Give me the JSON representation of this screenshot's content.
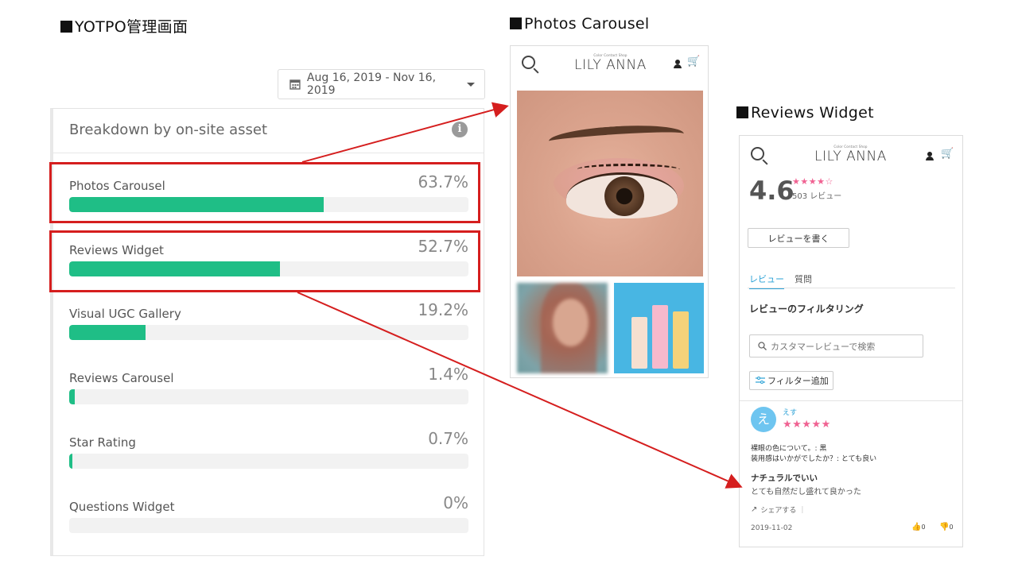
{
  "labels": {
    "yotpo": "YOTPO管理画面",
    "carousel": "Photos Carousel",
    "reviews": "Reviews Widget"
  },
  "dashboard": {
    "date_range": "Aug 16, 2019 - Nov 16, 2019",
    "panel_title": "Breakdown by on-site asset",
    "metrics": [
      {
        "label": "Photos Carousel",
        "value": "63.7%",
        "fraction": 0.637
      },
      {
        "label": "Reviews Widget",
        "value": "52.7%",
        "fraction": 0.527
      },
      {
        "label": "Visual UGC Gallery",
        "value": "19.2%",
        "fraction": 0.192
      },
      {
        "label": "Reviews Carousel",
        "value": "1.4%",
        "fraction": 0.014
      },
      {
        "label": "Star Rating",
        "value": "0.7%",
        "fraction": 0.007
      },
      {
        "label": "Questions Widget",
        "value": "0%",
        "fraction": 0.0
      }
    ],
    "bar_color": "#1fbe86",
    "highlight_color": "#d51e1e"
  },
  "carousel_phone": {
    "brand_small": "Color Contact Shop",
    "brand": "LILY ANNA"
  },
  "reviews_phone": {
    "brand_small": "Color Contact Shop",
    "brand": "LILY ANNA",
    "rating": "4.6",
    "stars": "★★★★☆",
    "review_count": "503 レビュー",
    "write_button": "レビューを書く",
    "tab_reviews": "レビュー",
    "tab_questions": "質問",
    "filter_heading": "レビューのフィルタリング",
    "search_placeholder": "カスタマーレビューで検索",
    "filter_button": "フィルター追加",
    "review": {
      "avatar_initial": "え",
      "author": "えす",
      "stars": "★★★★★",
      "q1": "裸眼の色について。: 黒",
      "q2": "装用感はいかがでしたか？: とても良い",
      "title": "ナチュラルでいい",
      "body": "とても自然だし盛れて良かった",
      "share": "シェアする",
      "date": "2019-11-02",
      "up_count": "0",
      "down_count": "0"
    },
    "accent": "#2aa1d6",
    "star_color": "#f06292"
  }
}
